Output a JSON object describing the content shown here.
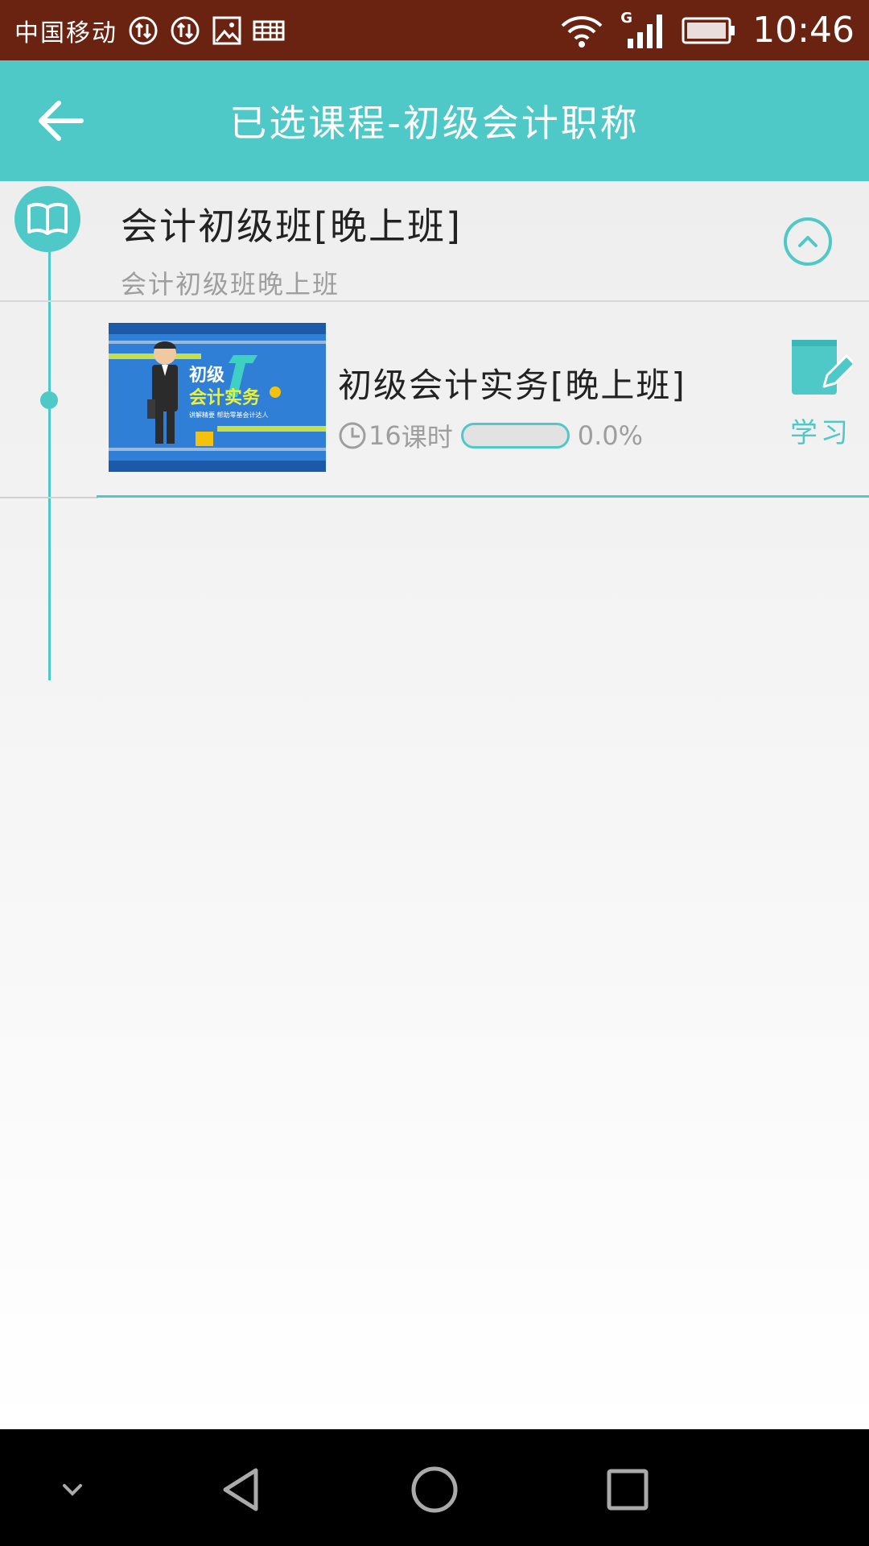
{
  "status_bar": {
    "carrier": "中国移动",
    "network_badge": "G",
    "time": "10:46"
  },
  "header": {
    "title": "已选课程-初级会计职称",
    "back_icon": "arrow-left-icon"
  },
  "course": {
    "title": "会计初级班[晚上班]",
    "subtitle": "会计初级班晚上班",
    "icon": "open-book-icon",
    "collapse_icon": "chevron-up-icon"
  },
  "lesson": {
    "title": "初级会计实务[晚上班]",
    "hours": "16",
    "hours_unit": "课时",
    "progress": 0.0,
    "progress_text": "0.0%",
    "study_label": "学习",
    "study_icon": "edit-note-icon",
    "thumbnail": {
      "title": "初级\n会计实务",
      "caption": "讲解精要  帮助零基会计达人"
    }
  },
  "nav_bar": {
    "items": [
      "chevron-down-icon",
      "back-triangle-icon",
      "home-circle-icon",
      "recents-square-icon"
    ]
  },
  "colors": {
    "accent": "#4fc8c8",
    "status_bar": "#6b2311",
    "nav_bar": "#000000"
  }
}
